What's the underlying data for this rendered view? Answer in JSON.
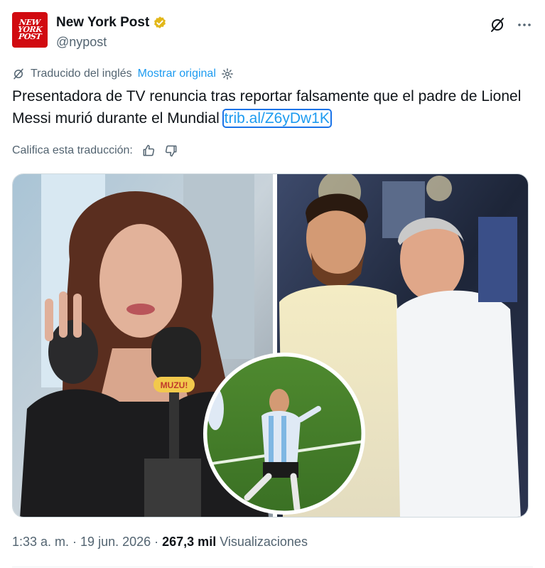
{
  "author": {
    "logo_lines": [
      "NEW",
      "YORK",
      "POST"
    ],
    "name": "New York Post",
    "handle": "@nypost",
    "verified_color": "#e2b719"
  },
  "translation": {
    "label": "Traducido del inglés",
    "show_original": "Mostrar original"
  },
  "tweet": {
    "text": "Presentadora de TV renuncia tras reportar falsamente que el padre de Lionel Messi murió durante el Mundial ",
    "link": "trib.al/Z6yDw1K"
  },
  "rate": {
    "label": "Califica esta traducción:"
  },
  "media": {
    "mic_sticker": "MUZU!"
  },
  "meta": {
    "time": "1:33 a. m.",
    "sep1": " · ",
    "date": "19 jun. 2026",
    "sep2": " · ",
    "views": "267,3 mil",
    "views_label": " Visualizaciones"
  },
  "colors": {
    "accent": "#1d9bf0",
    "brand": "#d10a10",
    "text": "#0f1419",
    "muted": "#536471"
  }
}
